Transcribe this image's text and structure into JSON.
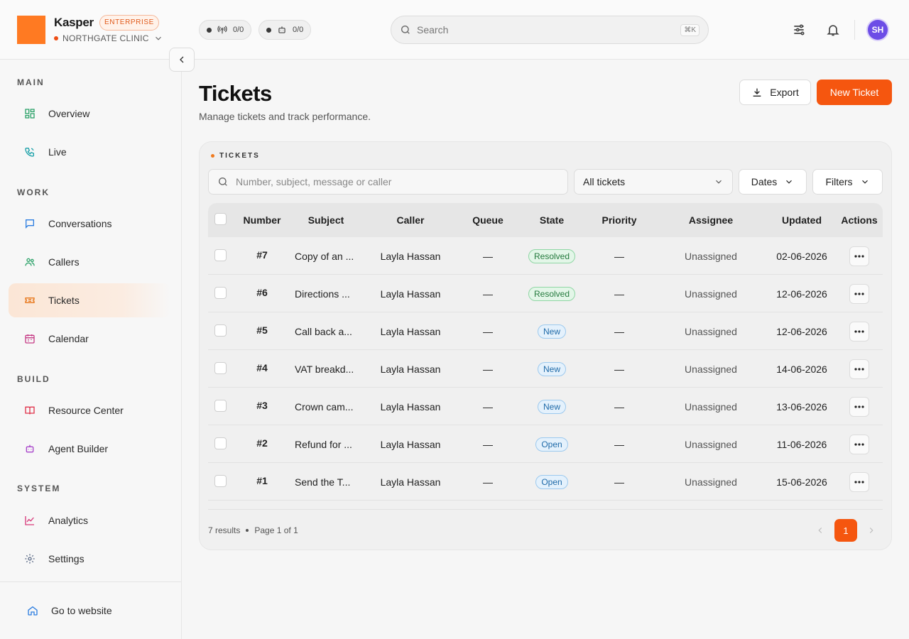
{
  "brand": {
    "name": "Kasper",
    "tier": "ENTERPRISE",
    "org": "NORTHGATE CLINIC",
    "accent": "#f5560f"
  },
  "status_pills": [
    {
      "icon": "broadcast-icon",
      "value": "0/0"
    },
    {
      "icon": "robot-icon",
      "value": "0/0"
    }
  ],
  "search": {
    "placeholder": "Search",
    "shortcut": "⌘K"
  },
  "user": {
    "initials": "SH"
  },
  "sidebar": {
    "sections": [
      "MAIN",
      "WORK",
      "BUILD",
      "SYSTEM"
    ],
    "items": [
      {
        "label": "Overview",
        "icon": "dashboard-icon"
      },
      {
        "label": "Live",
        "icon": "phone-icon"
      },
      {
        "label": "Conversations",
        "icon": "chat-icon"
      },
      {
        "label": "Callers",
        "icon": "users-icon"
      },
      {
        "label": "Tickets",
        "icon": "ticket-icon",
        "active": true
      },
      {
        "label": "Calendar",
        "icon": "calendar-icon"
      },
      {
        "label": "Resource Center",
        "icon": "book-icon"
      },
      {
        "label": "Agent Builder",
        "icon": "robot-icon"
      },
      {
        "label": "Analytics",
        "icon": "chart-icon"
      },
      {
        "label": "Settings",
        "icon": "gear-icon"
      }
    ],
    "footer": {
      "label": "Go to website",
      "icon": "home-icon"
    }
  },
  "page": {
    "title": "Tickets",
    "subtitle": "Manage tickets and track performance.",
    "export_label": "Export",
    "new_label": "New Ticket"
  },
  "card": {
    "title": "TICKETS",
    "search_placeholder": "Number, subject, message or caller",
    "select_value": "All tickets",
    "dates_label": "Dates",
    "filters_label": "Filters"
  },
  "table": {
    "columns": [
      "Number",
      "Subject",
      "Caller",
      "Queue",
      "State",
      "Priority",
      "Assignee",
      "Updated",
      "Actions"
    ],
    "rows": [
      {
        "number": "#7",
        "subject": "Copy of an ...",
        "caller": "Layla Hassan",
        "queue": "—",
        "state": "Resolved",
        "priority": "—",
        "assignee": "Unassigned",
        "updated": "02-06-2026"
      },
      {
        "number": "#6",
        "subject": "Directions ...",
        "caller": "Layla Hassan",
        "queue": "—",
        "state": "Resolved",
        "priority": "—",
        "assignee": "Unassigned",
        "updated": "12-06-2026"
      },
      {
        "number": "#5",
        "subject": "Call back a...",
        "caller": "Layla Hassan",
        "queue": "—",
        "state": "New",
        "priority": "—",
        "assignee": "Unassigned",
        "updated": "12-06-2026"
      },
      {
        "number": "#4",
        "subject": "VAT breakd...",
        "caller": "Layla Hassan",
        "queue": "—",
        "state": "New",
        "priority": "—",
        "assignee": "Unassigned",
        "updated": "14-06-2026"
      },
      {
        "number": "#3",
        "subject": "Crown cam...",
        "caller": "Layla Hassan",
        "queue": "—",
        "state": "New",
        "priority": "—",
        "assignee": "Unassigned",
        "updated": "13-06-2026"
      },
      {
        "number": "#2",
        "subject": "Refund for ...",
        "caller": "Layla Hassan",
        "queue": "—",
        "state": "Open",
        "priority": "—",
        "assignee": "Unassigned",
        "updated": "11-06-2026"
      },
      {
        "number": "#1",
        "subject": "Send the T...",
        "caller": "Layla Hassan",
        "queue": "—",
        "state": "Open",
        "priority": "—",
        "assignee": "Unassigned",
        "updated": "15-06-2026"
      }
    ]
  },
  "pagination": {
    "results": "7 results",
    "page_info": "Page 1 of 1",
    "current": "1"
  }
}
